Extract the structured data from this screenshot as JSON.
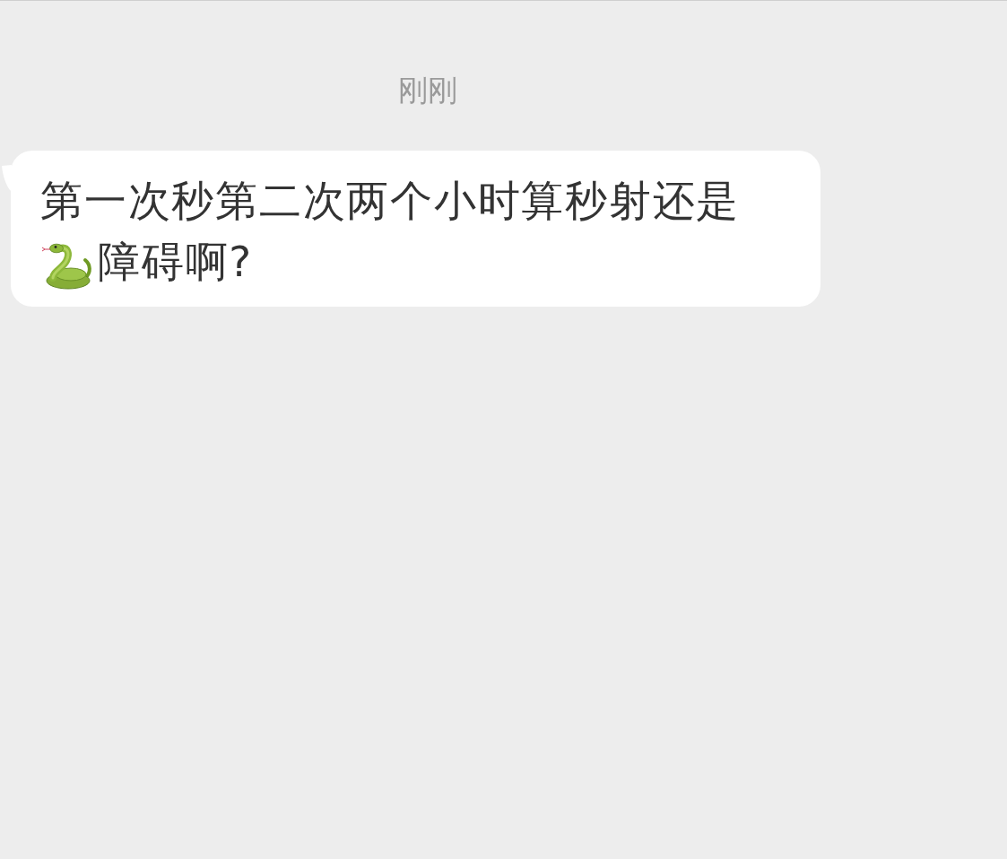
{
  "timestamp": "刚刚",
  "message": {
    "parts": [
      {
        "kind": "text",
        "text": "第一次秒第二次两个小时算秒射还是"
      },
      {
        "kind": "emoji"
      },
      {
        "kind": "text",
        "text": "障碍啊?"
      }
    ]
  }
}
